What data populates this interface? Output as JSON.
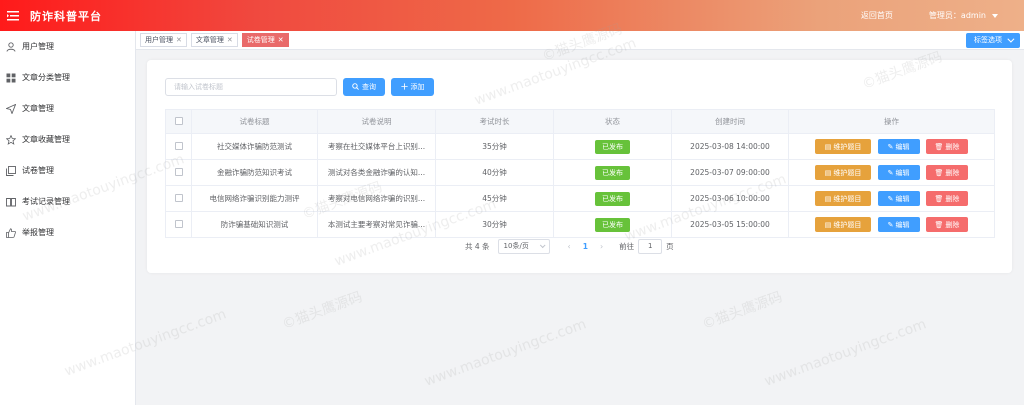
{
  "header": {
    "app_title": "防诈科普平台",
    "home_link": "返回首页",
    "admin_label": "管理员：admin"
  },
  "sidebar": {
    "items": [
      {
        "label": "用户管理",
        "icon": "user-icon"
      },
      {
        "label": "文章分类管理",
        "icon": "grid-icon"
      },
      {
        "label": "文章管理",
        "icon": "send-icon"
      },
      {
        "label": "文章收藏管理",
        "icon": "star-icon"
      },
      {
        "label": "试卷管理",
        "icon": "copy-icon"
      },
      {
        "label": "考试记录管理",
        "icon": "book-icon"
      },
      {
        "label": "举报管理",
        "icon": "thumb-icon"
      }
    ]
  },
  "tags": {
    "items": [
      {
        "label": "用户管理"
      },
      {
        "label": "文章管理"
      },
      {
        "label": "试卷管理",
        "active": true
      }
    ],
    "options_label": "标签选项"
  },
  "toolbar": {
    "search_placeholder": "请输入试卷标题",
    "query_label": "查询",
    "add_label": "添加"
  },
  "table": {
    "headers": [
      "",
      "试卷标题",
      "试卷说明",
      "考试时长",
      "状态",
      "创建时间",
      "操作"
    ],
    "rows": [
      {
        "title": "社交媒体诈骗防范测试",
        "desc": "考察在社交媒体平台上识别...",
        "duration": "35分钟",
        "status": "已发布",
        "created": "2025-03-08 14:00:00"
      },
      {
        "title": "金融诈骗防范知识考试",
        "desc": "测试对各类金融诈骗的认知...",
        "duration": "40分钟",
        "status": "已发布",
        "created": "2025-03-07 09:00:00"
      },
      {
        "title": "电信网络诈骗识别能力测评",
        "desc": "考察对电信网络诈骗的识别...",
        "duration": "45分钟",
        "status": "已发布",
        "created": "2025-03-06 10:00:00"
      },
      {
        "title": "防诈骗基础知识测试",
        "desc": "本测试主要考察对常见诈骗...",
        "duration": "30分钟",
        "status": "已发布",
        "created": "2025-03-05 15:00:00"
      }
    ],
    "actions": {
      "maintain": "维护题目",
      "edit": "编辑",
      "delete": "删除"
    }
  },
  "pagination": {
    "total": "共 4 条",
    "page_size": "10条/页",
    "current_page": "1",
    "goto_label": "前往",
    "goto_value": "1",
    "page_suffix": "页"
  },
  "watermark": {
    "text_a": "©猫头鹰源码",
    "text_b": "www.maotouyingcc.com"
  },
  "colors": {
    "primary": "#409eff",
    "success": "#67c23a",
    "warning": "#e6a23c",
    "danger": "#f56c6c",
    "active_tag": "#e96a6a"
  }
}
